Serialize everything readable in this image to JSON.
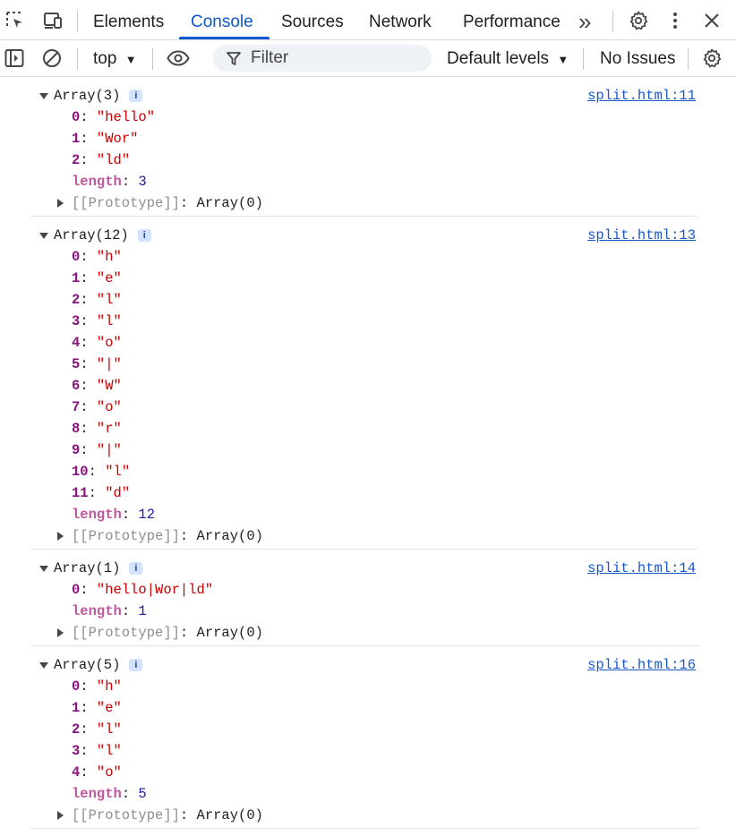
{
  "tabs": {
    "items": [
      {
        "label": "Elements",
        "active": false
      },
      {
        "label": "Console",
        "active": true
      },
      {
        "label": "Sources",
        "active": false
      },
      {
        "label": "Network",
        "active": false
      },
      {
        "label": "Performance",
        "active": false
      }
    ],
    "more": "»"
  },
  "toolbar": {
    "context": "top",
    "filter_placeholder": "Filter",
    "levels": "Default levels",
    "issues": "No Issues"
  },
  "colors": {
    "accent": "#0b57d0",
    "key": "#881280",
    "string": "#c80000",
    "number": "#1a1aa6",
    "link": "#1a58c8"
  },
  "logs": [
    {
      "summary": "Array(3)",
      "source": "split.html:11",
      "items": [
        {
          "key": "0",
          "value": "\"hello\"",
          "type": "string"
        },
        {
          "key": "1",
          "value": "\"Wor\"",
          "type": "string"
        },
        {
          "key": "2",
          "value": "\"ld\"",
          "type": "string"
        },
        {
          "key": "length",
          "value": "3",
          "type": "number"
        }
      ],
      "proto_key": "[[Prototype]]",
      "proto_value": "Array(0)"
    },
    {
      "summary": "Array(12)",
      "source": "split.html:13",
      "items": [
        {
          "key": "0",
          "value": "\"h\"",
          "type": "string"
        },
        {
          "key": "1",
          "value": "\"e\"",
          "type": "string"
        },
        {
          "key": "2",
          "value": "\"l\"",
          "type": "string"
        },
        {
          "key": "3",
          "value": "\"l\"",
          "type": "string"
        },
        {
          "key": "4",
          "value": "\"o\"",
          "type": "string"
        },
        {
          "key": "5",
          "value": "\"|\"",
          "type": "string"
        },
        {
          "key": "6",
          "value": "\"W\"",
          "type": "string"
        },
        {
          "key": "7",
          "value": "\"o\"",
          "type": "string"
        },
        {
          "key": "8",
          "value": "\"r\"",
          "type": "string"
        },
        {
          "key": "9",
          "value": "\"|\"",
          "type": "string"
        },
        {
          "key": "10",
          "value": "\"l\"",
          "type": "string"
        },
        {
          "key": "11",
          "value": "\"d\"",
          "type": "string"
        },
        {
          "key": "length",
          "value": "12",
          "type": "number"
        }
      ],
      "proto_key": "[[Prototype]]",
      "proto_value": "Array(0)"
    },
    {
      "summary": "Array(1)",
      "source": "split.html:14",
      "items": [
        {
          "key": "0",
          "value": "\"hello|Wor|ld\"",
          "type": "string"
        },
        {
          "key": "length",
          "value": "1",
          "type": "number"
        }
      ],
      "proto_key": "[[Prototype]]",
      "proto_value": "Array(0)"
    },
    {
      "summary": "Array(5)",
      "source": "split.html:16",
      "items": [
        {
          "key": "0",
          "value": "\"h\"",
          "type": "string"
        },
        {
          "key": "1",
          "value": "\"e\"",
          "type": "string"
        },
        {
          "key": "2",
          "value": "\"l\"",
          "type": "string"
        },
        {
          "key": "3",
          "value": "\"l\"",
          "type": "string"
        },
        {
          "key": "4",
          "value": "\"o\"",
          "type": "string"
        },
        {
          "key": "length",
          "value": "5",
          "type": "number"
        }
      ],
      "proto_key": "[[Prototype]]",
      "proto_value": "Array(0)"
    }
  ]
}
